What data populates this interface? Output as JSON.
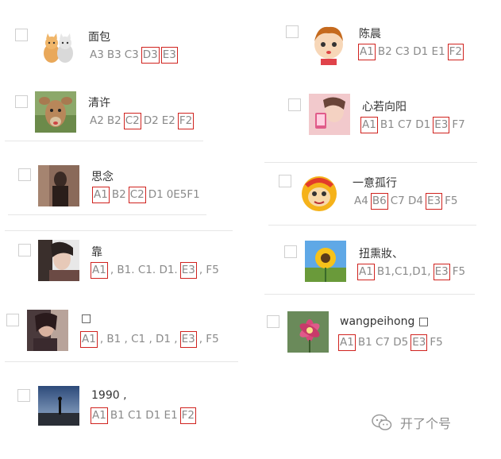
{
  "left": [
    {
      "name": "面包",
      "codes": [
        {
          "t": "A3",
          "h": false
        },
        {
          "t": "B3",
          "h": false
        },
        {
          "t": "C3",
          "h": false
        },
        {
          "t": "D3",
          "h": true
        },
        {
          "t": "E3",
          "h": true
        }
      ]
    },
    {
      "name": "清许",
      "codes": [
        {
          "t": "A2",
          "h": false
        },
        {
          "t": "B2",
          "h": false
        },
        {
          "t": "C2",
          "h": true
        },
        {
          "t": "D2",
          "h": false
        },
        {
          "t": "E2",
          "h": false
        },
        {
          "t": "F2",
          "h": true
        }
      ]
    },
    {
      "name": "思念",
      "codes": [
        {
          "t": "A1",
          "h": true
        },
        {
          "t": "B2",
          "h": false
        },
        {
          "t": "C2",
          "h": true
        },
        {
          "t": "D1",
          "h": false
        },
        {
          "t": "0E5F1",
          "h": false
        }
      ]
    },
    {
      "name": "靠",
      "codes": [
        {
          "t": "A1",
          "h": true
        },
        {
          "t": ", B1. C1. D1.",
          "h": false
        },
        {
          "t": "E3",
          "h": true
        },
        {
          "t": ", F5",
          "h": false
        }
      ]
    },
    {
      "name": "□",
      "codes": [
        {
          "t": "A1",
          "h": true
        },
        {
          "t": ", B1 , C1 , D1 ,",
          "h": false
        },
        {
          "t": "E3",
          "h": true
        },
        {
          "t": ", F5",
          "h": false
        }
      ]
    },
    {
      "name": "1990 ,",
      "codes": [
        {
          "t": "A1",
          "h": true
        },
        {
          "t": "B1 C1 D1 E1",
          "h": false
        },
        {
          "t": "F2",
          "h": true
        }
      ]
    }
  ],
  "right": [
    {
      "name": "陈晨",
      "codes": [
        {
          "t": "A1",
          "h": true
        },
        {
          "t": "B2 C3 D1 E1",
          "h": false
        },
        {
          "t": "F2",
          "h": true
        }
      ]
    },
    {
      "name": "心若向阳",
      "codes": [
        {
          "t": "A1",
          "h": true
        },
        {
          "t": "B1 C7 D1",
          "h": false
        },
        {
          "t": "E3",
          "h": true
        },
        {
          "t": "F7",
          "h": false
        }
      ]
    },
    {
      "name": "一意孤行",
      "codes": [
        {
          "t": "A4",
          "h": false
        },
        {
          "t": "B6",
          "h": true
        },
        {
          "t": "C7 D4",
          "h": false
        },
        {
          "t": "E3",
          "h": true
        },
        {
          "t": "F5",
          "h": false
        }
      ]
    },
    {
      "name": "扭熏妝、",
      "codes": [
        {
          "t": "A1",
          "h": true
        },
        {
          "t": "B1,C1,D1,",
          "h": false
        },
        {
          "t": "E3",
          "h": true
        },
        {
          "t": "F5",
          "h": false
        }
      ]
    },
    {
      "name": "wangpeihong □",
      "codes": [
        {
          "t": "A1",
          "h": true
        },
        {
          "t": "B1 C7 D5",
          "h": false
        },
        {
          "t": "E3",
          "h": true
        },
        {
          "t": "F5",
          "h": false
        }
      ]
    }
  ],
  "watermark": {
    "text": "开了个号",
    "icon": "wechat-icon"
  },
  "colors": {
    "highlight": "#d0231f",
    "code_text": "#8a8a8a",
    "name_text": "#333333"
  }
}
